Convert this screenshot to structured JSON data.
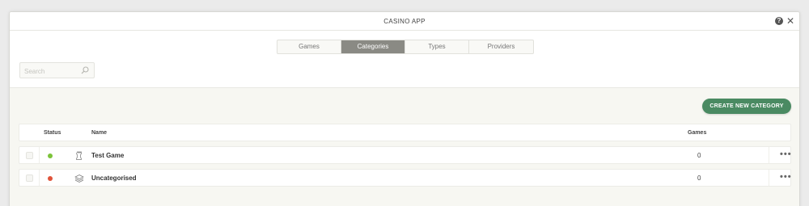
{
  "window": {
    "title": "CASINO APP"
  },
  "tabs": [
    {
      "label": "Games",
      "active": false
    },
    {
      "label": "Categories",
      "active": true
    },
    {
      "label": "Types",
      "active": false
    },
    {
      "label": "Providers",
      "active": false
    }
  ],
  "search": {
    "placeholder": "Search",
    "value": ""
  },
  "actions": {
    "create_label": "CREATE NEW CATEGORY"
  },
  "table": {
    "headers": {
      "status": "Status",
      "name": "Name",
      "games": "Games"
    },
    "rows": [
      {
        "name": "Test Game",
        "games": "0",
        "status_color": "#7cc33a",
        "icon": "chess-rook-icon"
      },
      {
        "name": "Uncategorised",
        "games": "0",
        "status_color": "#e0533a",
        "icon": "layers-icon"
      }
    ]
  },
  "colors": {
    "accent": "#4a8a62",
    "active_tab": "#8a8a84"
  }
}
